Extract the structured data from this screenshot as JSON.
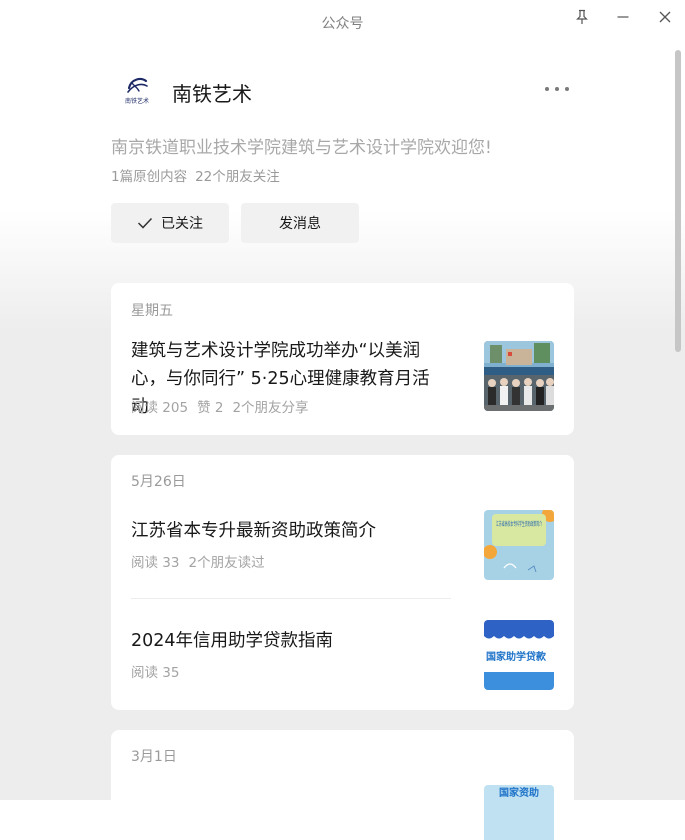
{
  "window": {
    "title": "公众号"
  },
  "account": {
    "name": "南铁艺术",
    "logo_text": "南铁艺术",
    "description": "南京铁道职业技术学院建筑与艺术设计学院欢迎您!",
    "original_count": "1篇原创内容",
    "friends_follow": "22个朋友关注",
    "follow_label": "已关注",
    "message_label": "发消息"
  },
  "groups": [
    {
      "date": "星期五",
      "articles": [
        {
          "title": "建筑与艺术设计学院成功举办“以美润心，与你同行” 5·25心理健康教育月活动",
          "meta": [
            "阅读 205",
            "赞 2",
            "2个朋友分享"
          ]
        }
      ]
    },
    {
      "date": "5月26日",
      "articles": [
        {
          "title": "江苏省本专升最新资助政策简介",
          "meta": [
            "阅读 33",
            "2个朋友读过"
          ],
          "thumb_text": "江苏省高校本专科学生资助政策简介"
        },
        {
          "title": "2024年信用助学贷款指南",
          "meta": [
            "阅读 35"
          ],
          "thumb_text": "国家助学贷款"
        }
      ]
    },
    {
      "date": "3月1日",
      "articles": [
        {
          "thumb_text": "国家资助"
        }
      ]
    }
  ],
  "colors": {
    "accent_blue": "#2e63c7",
    "background": "#ededed",
    "card": "#ffffff",
    "secondary_text": "#9a9a9a"
  },
  "icons": [
    "pin-icon",
    "minimize-icon",
    "close-icon",
    "more-icon",
    "check-icon"
  ]
}
